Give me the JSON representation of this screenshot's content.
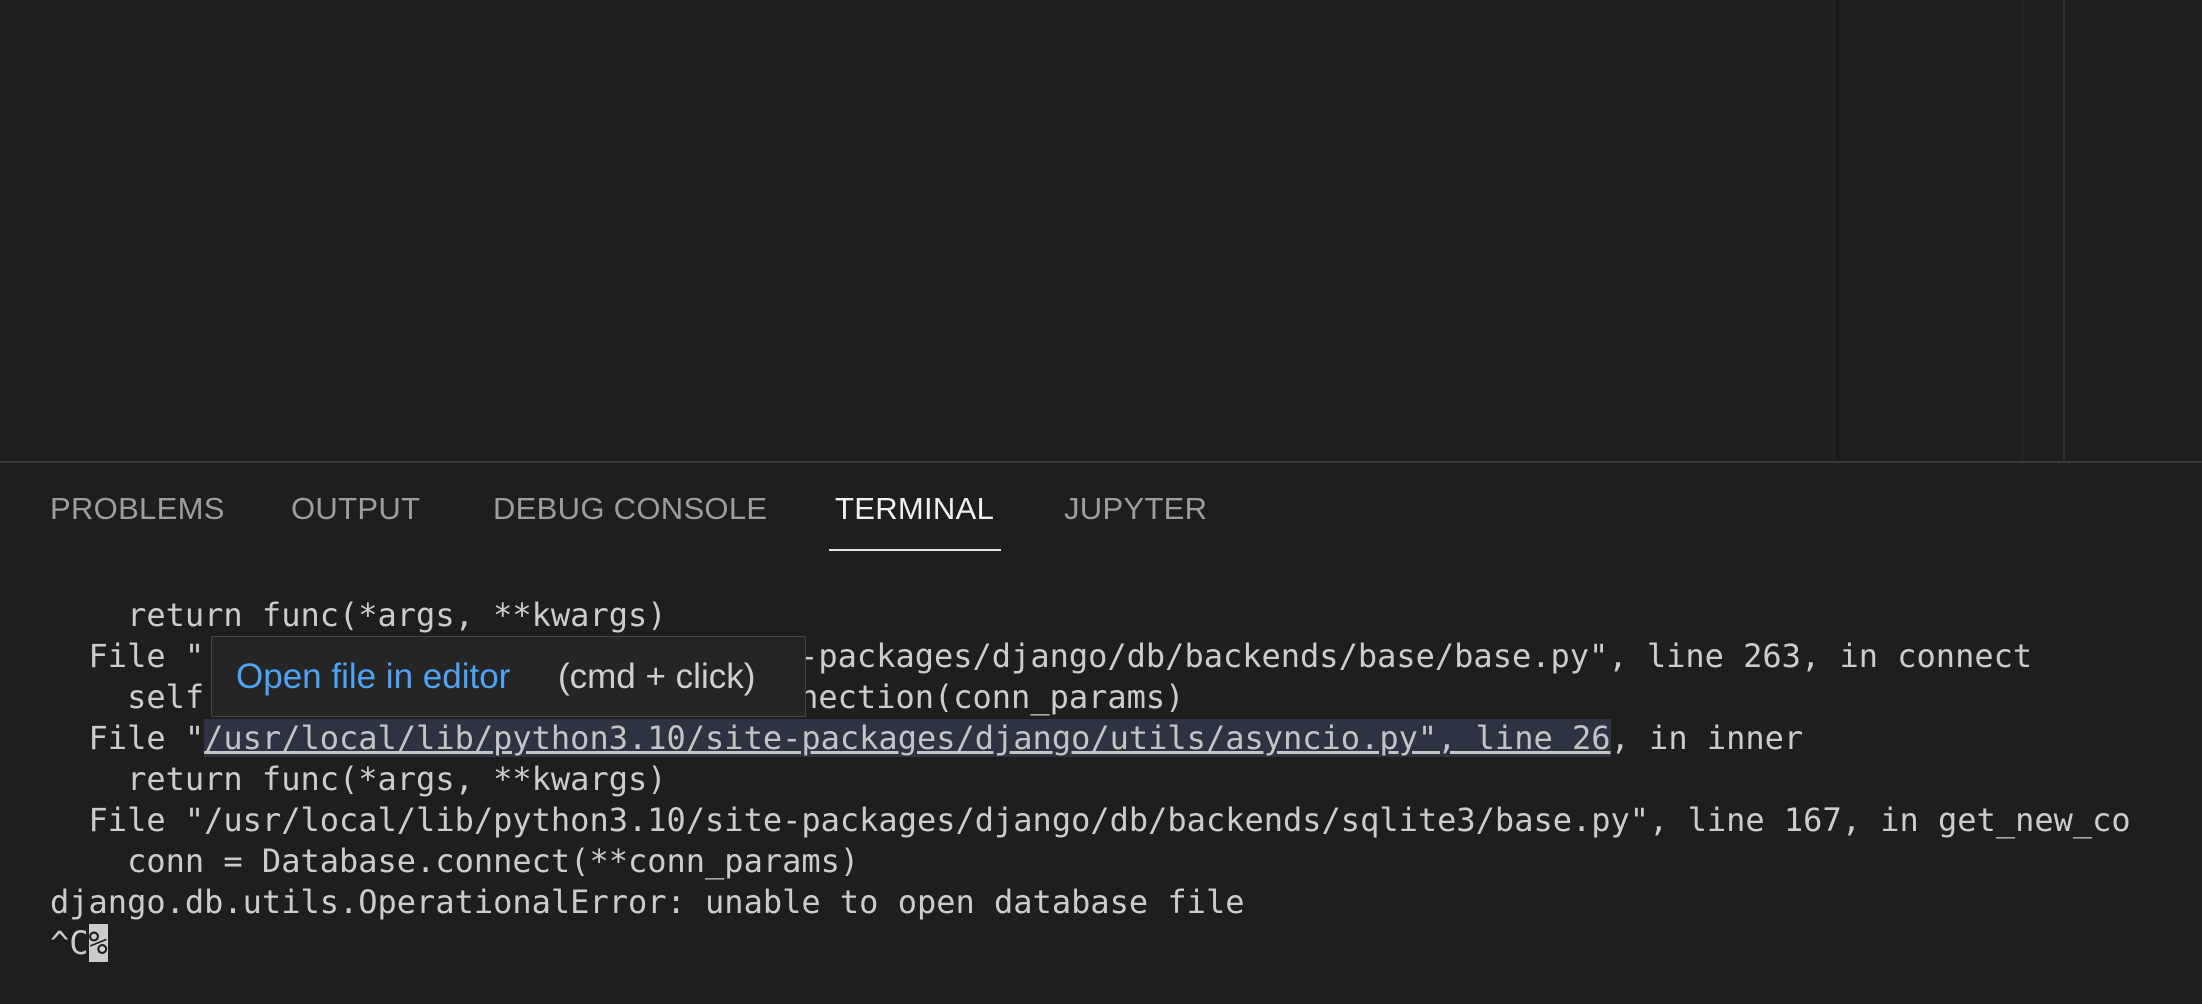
{
  "panel": {
    "tabs": [
      {
        "label": "PROBLEMS"
      },
      {
        "label": "OUTPUT"
      },
      {
        "label": "DEBUG CONSOLE"
      },
      {
        "label": "TERMINAL",
        "active": true
      },
      {
        "label": "JUPYTER"
      }
    ]
  },
  "terminal": {
    "line1": "    return func(*args, **kwargs)",
    "line2_prefix": "  File \"",
    "line2_rest": "-packages/django/db/backends/base/base.py\", line 263, in connect",
    "line3_prefix": "    self",
    "line3_rest": "nection(conn_params)",
    "line4_prefix": "  File \"",
    "line4_link": "/usr/local/lib/python3.10/site-packages/django/utils/asyncio.py\", line 26",
    "line4_suffix": ", in inner",
    "line5": "    return func(*args, **kwargs)",
    "line6": "  File \"/usr/local/lib/python3.10/site-packages/django/db/backends/sqlite3/base.py\", line 167, in get_new_co",
    "line7": "    conn = Database.connect(**conn_params)",
    "line8": "django.db.utils.OperationalError: unable to open database file",
    "line9_prefix": "^C",
    "line9_cursor": "%"
  },
  "tooltip": {
    "link_text": "Open file in editor",
    "hint": "(cmd + click)"
  },
  "colors": {
    "background": "#1e1e1e",
    "link_blue": "#4ea3f5",
    "active_tab": "#f0f0f0",
    "inactive_tab": "#9d9d9d"
  }
}
